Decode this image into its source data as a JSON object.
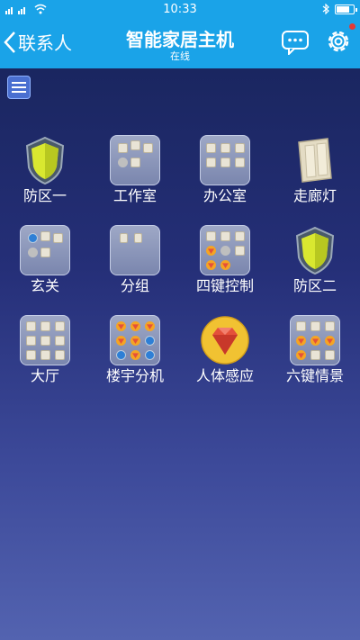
{
  "status_bar": {
    "left_text": "2G 4G",
    "time": "10:33",
    "icons": [
      "signal-icon",
      "wifi-icon",
      "bluetooth-icon",
      "battery-icon"
    ]
  },
  "nav": {
    "back_label": "联系人",
    "title": "智能家居主机",
    "subtitle": "在线",
    "message_icon": "chat-bubble-icon",
    "settings_icon": "gear-icon",
    "accent": "#1aa3e8"
  },
  "menu": {
    "icon": "hamburger-menu-icon"
  },
  "tiles": [
    {
      "label": "防区一",
      "icon": "shield-icon"
    },
    {
      "label": "工作室",
      "icon": "folder-icon"
    },
    {
      "label": "办公室",
      "icon": "folder-icon"
    },
    {
      "label": "走廊灯",
      "icon": "wall-switch-icon"
    },
    {
      "label": "玄关",
      "icon": "folder-icon"
    },
    {
      "label": "分组",
      "icon": "folder-icon"
    },
    {
      "label": "四键控制",
      "icon": "folder-icon"
    },
    {
      "label": "防区二",
      "icon": "shield-icon"
    },
    {
      "label": "大厅",
      "icon": "folder-icon"
    },
    {
      "label": "楼宇分机",
      "icon": "folder-icon"
    },
    {
      "label": "人体感应",
      "icon": "gem-sensor-icon"
    },
    {
      "label": "六键情景",
      "icon": "folder-icon"
    }
  ]
}
